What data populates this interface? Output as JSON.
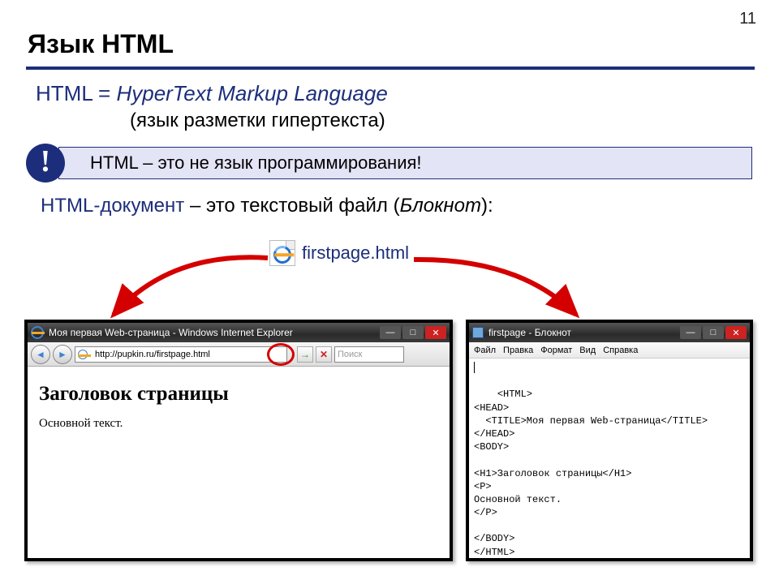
{
  "page_number": "11",
  "heading": "Язык HTML",
  "definition": {
    "prefix": "HTML = ",
    "expansion": "HyperText Markup Language",
    "translation": "(язык разметки гипертекста)"
  },
  "alert": {
    "icon": "!",
    "text": "HTML – это не язык программирования!"
  },
  "doc_sentence": {
    "term": "HTML-документ",
    "rest": " – это текстовый файл (",
    "app": "Блокнот",
    "after": "):"
  },
  "file": {
    "name": "firstpage.html"
  },
  "browser": {
    "title": "Моя первая Web-страница - Windows Internet Explorer",
    "url": "http://pupkin.ru/firstpage.html",
    "search_placeholder": "Поиск",
    "page_h1": "Заголовок страницы",
    "page_text": "Основной текст."
  },
  "notepad": {
    "title": "firstpage - Блокнот",
    "menu": [
      "Файл",
      "Правка",
      "Формат",
      "Вид",
      "Справка"
    ],
    "content": "<HTML>\n<HEAD>\n  <TITLE>Моя первая Web-страница</TITLE>\n</HEAD>\n<BODY>\n\n<H1>Заголовок страницы</H1>\n<P>\nОсновной текст.\n</P>\n\n</BODY>\n</HTML>"
  }
}
